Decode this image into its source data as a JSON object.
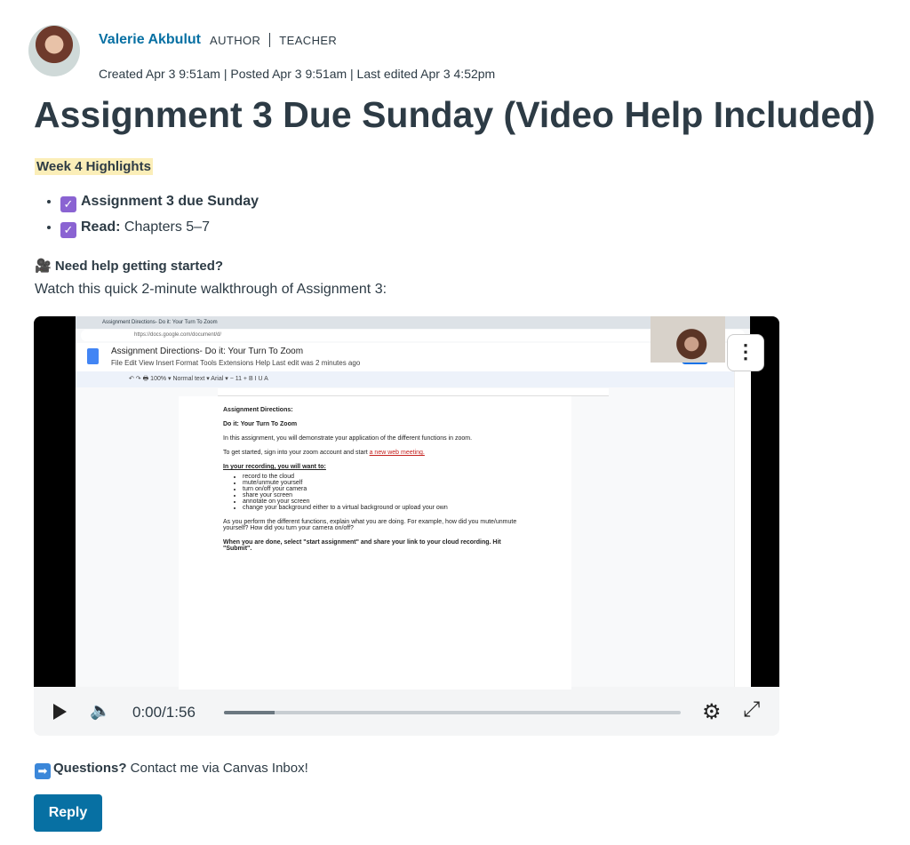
{
  "author": {
    "name": "Valerie Akbulut",
    "roles": [
      "AUTHOR",
      "TEACHER"
    ],
    "meta": "Created Apr 3 9:51am | Posted Apr 3 9:51am | Last edited Apr 3 4:52pm"
  },
  "title": "Assignment 3 Due Sunday (Video Help Included)",
  "highlights_label": "Week 4 Highlights",
  "items": [
    {
      "bold": "Assignment 3 due Sunday",
      "text": ""
    },
    {
      "bold": "Read:",
      "text": " Chapters 5–7"
    }
  ],
  "help": {
    "icon": "🎥",
    "heading": "Need help getting started?",
    "subtext": "Watch this quick 2-minute walkthrough of Assignment 3:"
  },
  "video": {
    "time": "0:00/1:56",
    "buffered_fraction": 0.11,
    "doc_title": "Assignment Directions- Do it: Your Turn To Zoom",
    "doc_menu": "File  Edit  View  Insert  Format  Tools  Extensions  Help   Last edit was 2 minutes ago",
    "url": "https://docs.google.com/document/d/",
    "doc_heading": "Assignment Directions:",
    "doc_subheading": "Do it: Your Turn To Zoom",
    "doc_p1": "In this assignment, you will demonstrate your application of the different functions in zoom.",
    "doc_p2_prefix": "To get started, sign into your zoom account and start ",
    "doc_p2_link": "a new web meeting.",
    "doc_list_title": "In your recording, you will want to:",
    "doc_list": [
      "record to the cloud",
      "mute/unmute yourself",
      "turn on/off your camera",
      "share your screen",
      "annotate on your screen",
      "change your background either to a virtual background or upload your own"
    ],
    "doc_p3": "As you perform the different functions, explain what you are doing. For example, how did you mute/unmute yourself? How did you turn your camera on/off?",
    "doc_p4": "When you are done, select \"start assignment\" and share your link to your cloud recording. Hit \"Submit\"."
  },
  "questions": {
    "bold": "Questions?",
    "text": " Contact me via Canvas Inbox!"
  },
  "reply_label": "Reply"
}
